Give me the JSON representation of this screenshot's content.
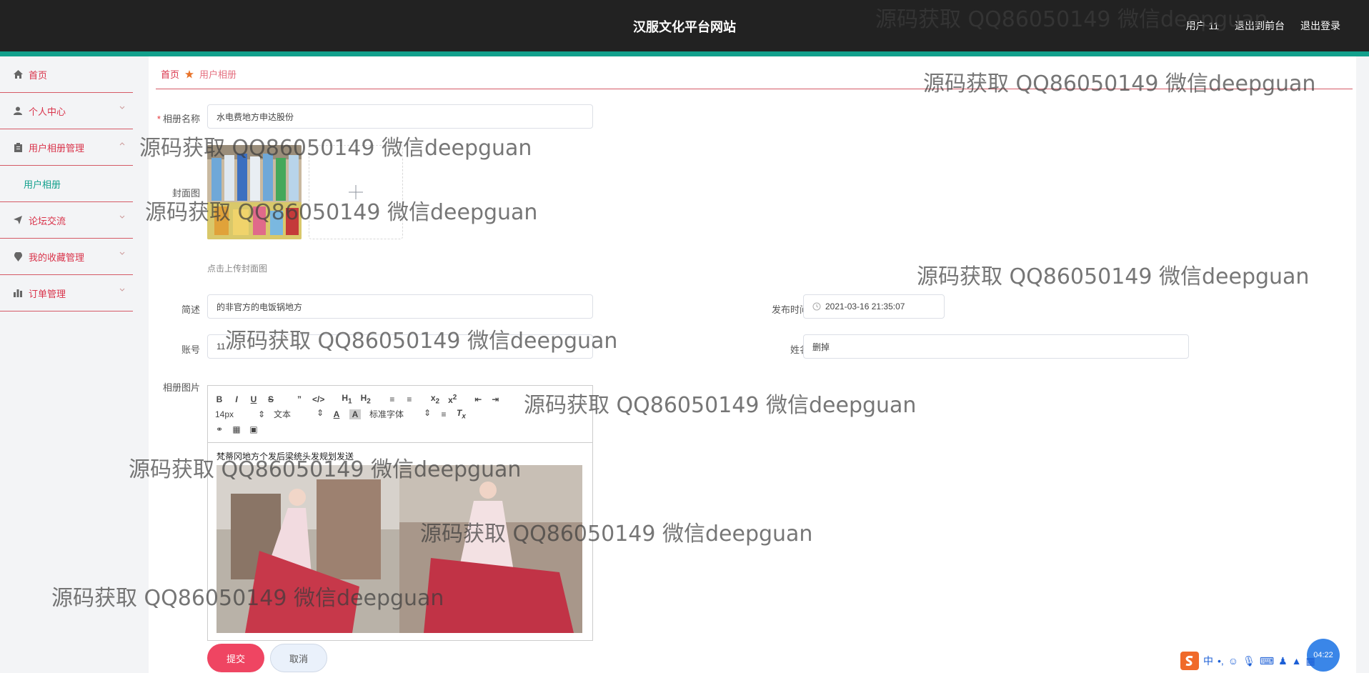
{
  "header": {
    "title": "汉服文化平台网站",
    "user": "用户 11",
    "front_link": "退出到前台",
    "logout": "退出登录"
  },
  "sidebar": {
    "items": [
      {
        "label": "首页",
        "icon": "home-icon"
      },
      {
        "label": "个人中心",
        "icon": "user-icon"
      },
      {
        "label": "用户相册管理",
        "icon": "clipboard-icon",
        "expanded": true
      },
      {
        "label": "用户相册",
        "icon": ""
      },
      {
        "label": "论坛交流",
        "icon": "paper-plane-icon"
      },
      {
        "label": "我的收藏管理",
        "icon": "location-pin-icon"
      },
      {
        "label": "订单管理",
        "icon": "bar-chart-icon"
      }
    ]
  },
  "breadcrumb": {
    "home": "首页",
    "current": "用户相册"
  },
  "form": {
    "album_name_label": "相册名称",
    "album_name_value": "水电费地方申达股份",
    "cover_label": "封面图",
    "upload_hint": "点击上传封面图",
    "desc_label": "简述",
    "desc_value": "的非官方的电饭锅地方",
    "publish_time_label": "发布时间",
    "publish_time_value": "2021-03-16 21:35:07",
    "account_label": "账号",
    "account_value": "11",
    "name_label": "姓名",
    "name_value": "删掉",
    "photos_label": "相册图片",
    "editor": {
      "font_size": "14px",
      "text_type": "文本",
      "font_family": "标准字体",
      "content_text": "梵蒂冈地方个发后梁统头发规划发送"
    },
    "submit": "提交",
    "cancel": "取消"
  },
  "watermark": "源码获取 QQ86050149 微信deepguan",
  "clock": "04:22",
  "colors": {
    "accent": "#d9334a",
    "teal": "#12a08c",
    "header": "#222222",
    "submit": "#ef4562"
  }
}
